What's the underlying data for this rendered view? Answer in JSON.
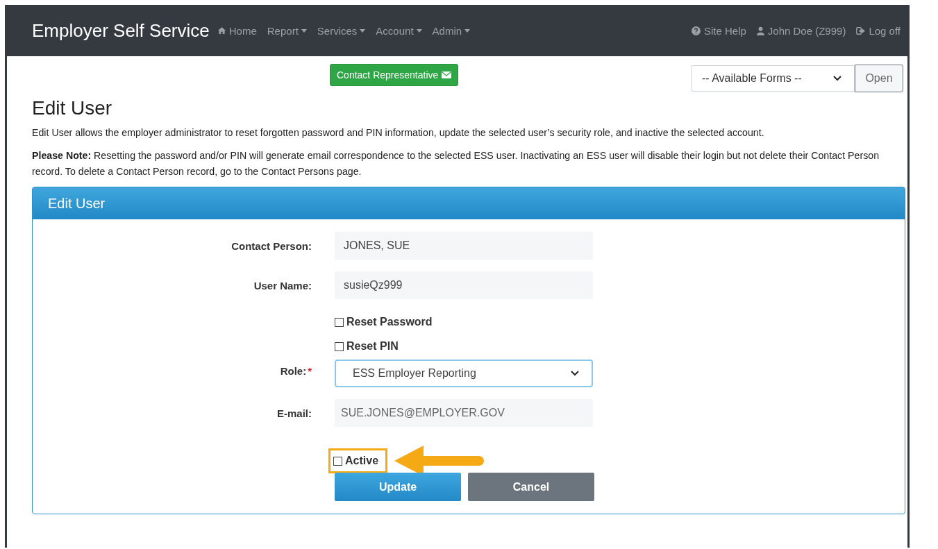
{
  "brand": "Employer Self Service",
  "nav": [
    {
      "label": "Home",
      "dropdown": false
    },
    {
      "label": "Report",
      "dropdown": true
    },
    {
      "label": "Services",
      "dropdown": true
    },
    {
      "label": "Account",
      "dropdown": true
    },
    {
      "label": "Admin",
      "dropdown": true
    }
  ],
  "nav_right": [
    {
      "label": "Site Help"
    },
    {
      "label": "John Doe (Z999)"
    },
    {
      "label": "Log off"
    }
  ],
  "contact_button": "Contact Representative",
  "forms_select": {
    "value": "-- Available Forms --"
  },
  "open_button": "Open",
  "heading": "Edit User",
  "intro": "Edit User allows the employer administrator to reset forgotten password and PIN information, update the selected user’s security role, and inactive the selected account.",
  "note": "**Please Note:** Resetting the password and/or PIN will generate email correspondence to the selected ESS user. Inactivating an ESS user will disable their login but not delete their Contact Person record. To delete a Contact Person record, go to the Contact Persons page.",
  "panel": {
    "title": "Edit User",
    "fields": [
      {
        "kind": "text",
        "label": "Contact Person:",
        "value": "JONES, SUE"
      },
      {
        "kind": "text",
        "label": "User Name:",
        "value": "susieQz999"
      },
      {
        "kind": "checkbox",
        "label": "Reset Password",
        "checked": false,
        "highlighted": false
      },
      {
        "kind": "checkbox",
        "label": "Reset PIN",
        "checked": false,
        "highlighted": false
      },
      {
        "kind": "select",
        "label": "Role:",
        "required_mark": "*",
        "value": "ESS Employer Reporting"
      },
      {
        "kind": "text",
        "label": "E-mail:",
        "value": "SUE.JONES@EMPLOYER.GOV"
      },
      {
        "kind": "checkbox",
        "label": "Active",
        "checked": false,
        "highlighted": true
      }
    ],
    "buttons": [
      {
        "label": "Update",
        "kind": "primary"
      },
      {
        "label": "Cancel",
        "kind": "secondary"
      }
    ]
  }
}
